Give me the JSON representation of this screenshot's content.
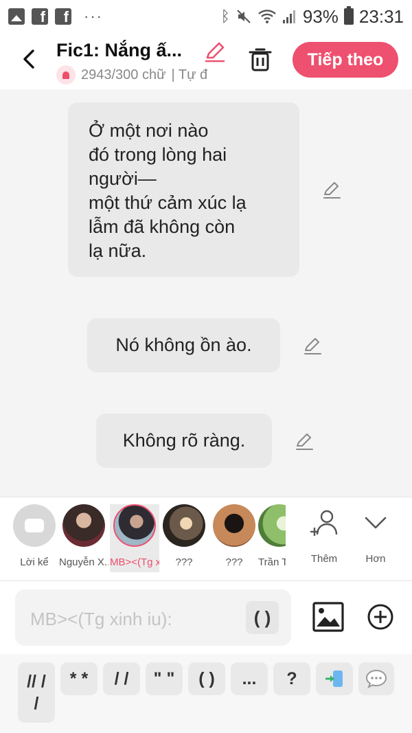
{
  "status_bar": {
    "battery": "93%",
    "time": "23:31",
    "dots": "···"
  },
  "header": {
    "title": "Fic1: Nắng ấ...",
    "word_count": "2943/300 chữ",
    "mode": "| Tự đ",
    "next_label": "Tiếp theo",
    "accent_color": "#ee506f"
  },
  "messages": [
    {
      "text": "Ở một nơi nào\nđó trong lòng hai\nngười—\nmột thứ cảm xúc lạ\nlẫm đã không còn\nlạ nữa."
    },
    {
      "text": "Nó không ồn ào."
    },
    {
      "text": "Không rõ ràng."
    }
  ],
  "characters": [
    {
      "name": "Lời kể",
      "icon": "narrator-icon"
    },
    {
      "name": "Nguyễn X..."
    },
    {
      "name": "MB><(Tg x...",
      "selected": true
    },
    {
      "name": "???"
    },
    {
      "name": "???"
    },
    {
      "name": "Trần T"
    }
  ],
  "actions": {
    "add_label": "Thêm",
    "more_label": "Hơn"
  },
  "composer": {
    "placeholder": "MB><(Tg xinh iu):",
    "paren_button": "( )"
  },
  "shortcuts": [
    "// /\n/",
    "* *",
    "/ /",
    "\" \"",
    "( )",
    "...",
    "?"
  ]
}
